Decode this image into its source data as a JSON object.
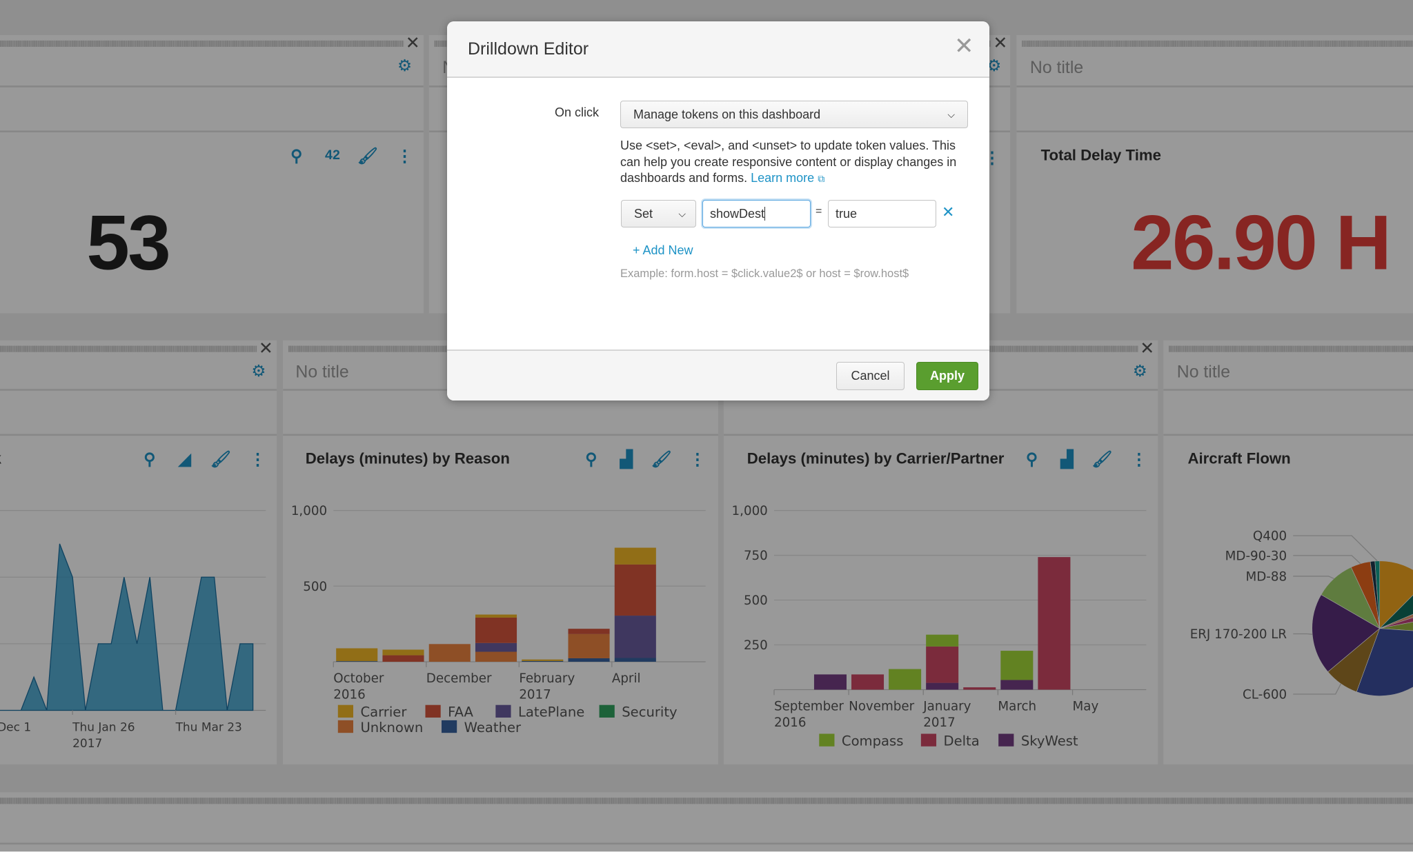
{
  "dashboard": {
    "top_left_panel": {
      "value": "53",
      "trend": "42"
    },
    "top_right_panel": {
      "header": "No title",
      "title": "Total Delay Time",
      "value": "26.90 H",
      "value_color": "#e23f3a"
    },
    "top_middle_panel": {
      "header_partial": "N"
    },
    "row2": {
      "area_panel": {
        "title_partial": "k"
      },
      "reason_panel": {
        "header": "No title",
        "title": "Delays (minutes) by Reason"
      },
      "carrier_panel": {
        "title": "Delays (minutes) by Carrier/Partner"
      },
      "pie_panel": {
        "header": "No title",
        "title": "Aircraft Flown"
      }
    },
    "icon_color": "#1e93c6"
  },
  "chart_data": [
    {
      "type": "area",
      "x_tick_labels": [
        [
          "Dec 1",
          ""
        ],
        [
          "Thu Jan 26",
          "2017"
        ],
        [
          "Thu Mar 23",
          ""
        ]
      ],
      "x": [
        "2016-12-01",
        "2016-12-08",
        "2016-12-15",
        "2016-12-22",
        "2016-12-29",
        "2017-01-05",
        "2017-01-12",
        "2017-01-19",
        "2017-01-26",
        "2017-02-02",
        "2017-02-09",
        "2017-02-16",
        "2017-02-23",
        "2017-03-02",
        "2017-03-09",
        "2017-03-16",
        "2017-03-23",
        "2017-03-30",
        "2017-04-06",
        "2017-04-13",
        "2017-04-20",
        "2017-04-27",
        "2017-05-04"
      ],
      "values": [
        0,
        0,
        0,
        0,
        0,
        0.5,
        0,
        2.5,
        2,
        0,
        1,
        1,
        2,
        1,
        2,
        0,
        0,
        1,
        2,
        2,
        0,
        1,
        1
      ],
      "ylim": [
        0,
        3
      ],
      "grid": true,
      "color": "#1e93c6"
    },
    {
      "type": "bar",
      "stacked": true,
      "title": "Delays (minutes) by Reason",
      "categories": [
        "Oct 2016",
        "Nov 2016",
        "Dec 2016",
        "Jan 2017",
        "Feb 2017",
        "Mar 2017",
        "Apr 2017"
      ],
      "x_tick_labels": [
        [
          "October",
          "2016"
        ],
        [
          "December",
          ""
        ],
        [
          "February",
          "2017"
        ],
        [
          "April",
          ""
        ]
      ],
      "y_ticks": [
        "500",
        "1,000"
      ],
      "ylim": [
        0,
        1000
      ],
      "grid": true,
      "legend": "bottom",
      "series": [
        {
          "name": "Weather",
          "color": "#3863a0",
          "values": [
            4,
            0,
            0,
            0,
            5,
            23,
            25
          ]
        },
        {
          "name": "Unknown",
          "color": "#ed8440",
          "values": [
            0,
            0,
            117,
            66,
            0,
            160,
            0
          ]
        },
        {
          "name": "LatePlane",
          "color": "#6a5c9e",
          "values": [
            0,
            0,
            0,
            58,
            0,
            0,
            280
          ]
        },
        {
          "name": "FAA",
          "color": "#d6563c",
          "values": [
            0,
            43,
            0,
            168,
            0,
            35,
            338
          ]
        },
        {
          "name": "Carrier",
          "color": "#f2b827",
          "values": [
            85,
            37,
            0,
            20,
            10,
            0,
            111
          ]
        },
        {
          "name": "Security",
          "color": "#31a35f",
          "values": [
            0,
            0,
            0,
            0,
            0,
            0,
            0
          ]
        }
      ],
      "legend_order": [
        "Carrier",
        "FAA",
        "LatePlane",
        "Security",
        "Unknown",
        "Weather"
      ]
    },
    {
      "type": "bar",
      "stacked": true,
      "title": "Delays (minutes) by Carrier/Partner",
      "categories": [
        "Sep 2016",
        "Oct 2016",
        "Nov 2016",
        "Dec 2016",
        "Jan 2017",
        "Feb 2017",
        "Mar 2017",
        "Apr 2017"
      ],
      "x_tick_labels": [
        [
          "September",
          "2016"
        ],
        [
          "November",
          ""
        ],
        [
          "January",
          "2017"
        ],
        [
          "March",
          ""
        ],
        [
          "May",
          ""
        ]
      ],
      "y_ticks": [
        "250",
        "500",
        "750",
        "1,000"
      ],
      "ylim": [
        0,
        1000
      ],
      "grid": true,
      "legend": "bottom",
      "series": [
        {
          "name": "SkyWest",
          "color": "#753e84",
          "values": [
            0,
            85,
            0,
            0,
            38,
            0,
            54,
            0
          ]
        },
        {
          "name": "Delta",
          "color": "#cd4964",
          "values": [
            0,
            0,
            85,
            0,
            203,
            13,
            0,
            740
          ]
        },
        {
          "name": "Compass",
          "color": "#a3d939",
          "values": [
            0,
            0,
            0,
            115,
            66,
            0,
            163,
            0
          ]
        }
      ],
      "legend_order": [
        "Compass",
        "Delta",
        "SkyWest"
      ]
    },
    {
      "type": "pie",
      "title": "Aircraft Flown",
      "labels": [
        "Q400",
        "MD-90-30",
        "MD-88",
        "ERJ 170-200 LR",
        "CL-600"
      ],
      "slices": [
        {
          "label": "",
          "color": "#f2a61e",
          "value": 45
        },
        {
          "label": "",
          "color": "#0f6b5a",
          "value": 22
        },
        {
          "label": "",
          "color": "#e99a6f",
          "value": 5
        },
        {
          "label": "",
          "color": "#c2417c",
          "value": 7
        },
        {
          "label": "",
          "color": "#99b540",
          "value": 15
        },
        {
          "label": "",
          "color": "#3c4f9e",
          "value": 106
        },
        {
          "label": "CL-600",
          "color": "#9d752a",
          "value": 30
        },
        {
          "label": "ERJ 170-200 LR",
          "color": "#5a307b",
          "value": 70
        },
        {
          "label": "MD-88",
          "color": "#9ecf69",
          "value": 35
        },
        {
          "label": "MD-90-30",
          "color": "#e9671e",
          "value": 17
        },
        {
          "label": "",
          "color": "#1d3a4f",
          "value": 4
        },
        {
          "label": "Q400",
          "color": "#14a08e",
          "value": 4
        }
      ]
    }
  ],
  "modal": {
    "title": "Drilldown Editor",
    "on_click_label": "On click",
    "on_click_value": "Manage tokens on this dashboard",
    "description": "Use <set>, <eval>, and <unset> to update token values. This can help you create responsive content or display changes in dashboards and forms.",
    "learn_more": "Learn more",
    "action_value": "Set",
    "token_name": "showDest",
    "equals": "=",
    "token_value": "true",
    "add_new": "+ Add New",
    "example": "Example: form.host = $click.value2$ or host = $row.host$",
    "cancel": "Cancel",
    "apply": "Apply",
    "apply_color": "#5a9e2f"
  }
}
